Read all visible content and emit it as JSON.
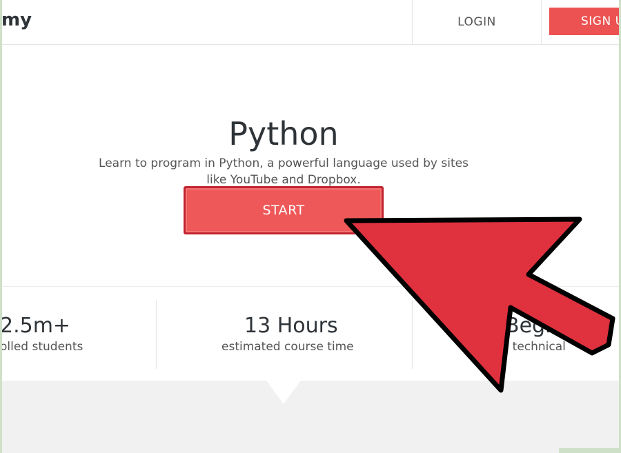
{
  "header": {
    "logo_text": "my",
    "login_label": "LOGIN",
    "signup_label": "SIGN U"
  },
  "course": {
    "title": "Python",
    "description": "Learn to program in Python, a powerful language used by sites like YouTube and Dropbox.",
    "start_label": "START"
  },
  "stats": [
    {
      "value": "2.5m+",
      "label": "olled students"
    },
    {
      "value": "13 Hours",
      "label": "estimated course time"
    },
    {
      "value": "Begi",
      "label": "ed technical"
    }
  ],
  "colors": {
    "accent": "#ec5252",
    "arrow_fill": "#e0313e",
    "arrow_outline": "#000000"
  },
  "overlay": {
    "icon": "pointer-arrow-icon"
  }
}
